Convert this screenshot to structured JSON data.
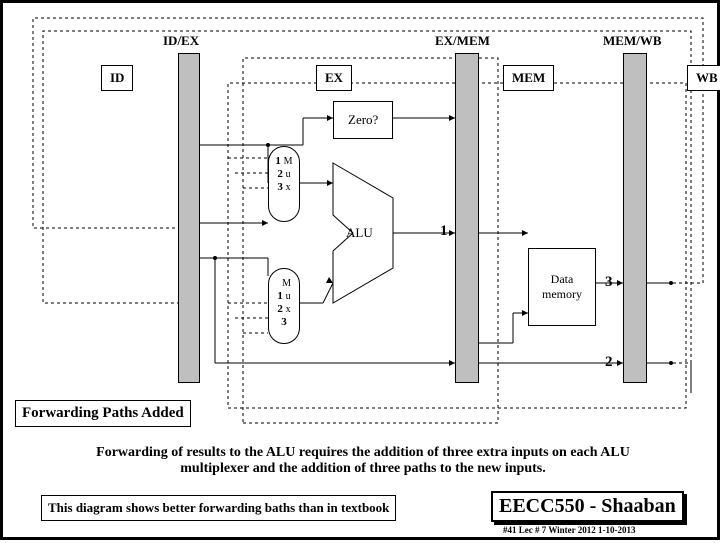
{
  "stage_headers": {
    "idex": "ID/EX",
    "exmem": "EX/MEM",
    "memwb": "MEM/WB"
  },
  "stage_boxes": {
    "id": "ID",
    "ex": "EX",
    "mem": "MEM",
    "wb": "WB"
  },
  "blocks": {
    "zero": "Zero?",
    "alu": "ALU",
    "mem": "Data\nmemory"
  },
  "mux_top": {
    "n1": "1",
    "n2": "2",
    "n3": "3",
    "label": "M\nu\nx"
  },
  "mux_bot": {
    "n1": "1",
    "n2": "2",
    "n3": "3",
    "label": "M\nu\nx"
  },
  "out": {
    "one": "1",
    "two": "2",
    "three": "3"
  },
  "annot": {
    "fwd": "Forwarding Paths Added"
  },
  "caption": "Forwarding of results to the ALU requires the addition of three extra inputs on each ALU multiplexer and the addition of three paths to the new inputs.",
  "note": "This diagram shows better forwarding baths than in textbook",
  "course": "EECC550 - Shaaban",
  "footer": "#41   Lec # 7  Winter 2012  1-10-2013"
}
